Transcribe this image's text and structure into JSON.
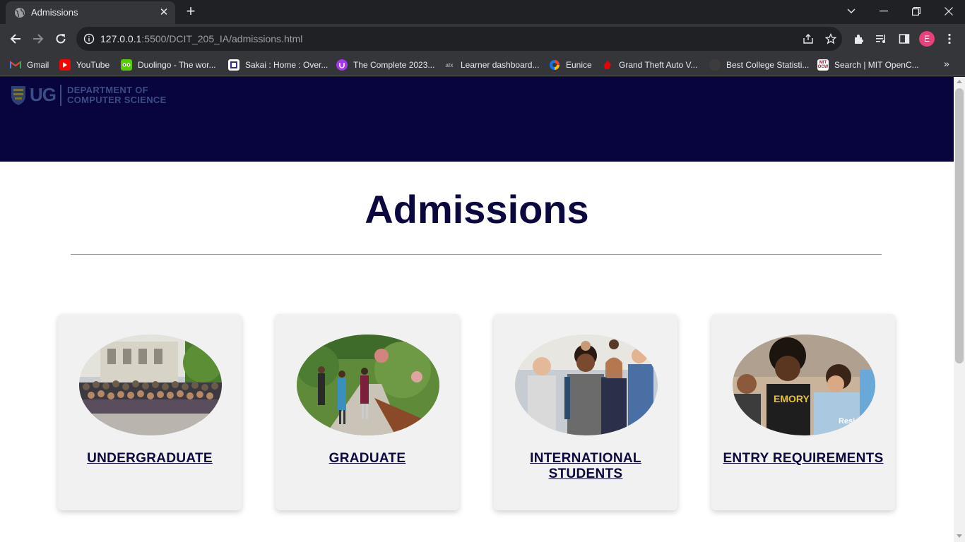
{
  "browser": {
    "tab_title": "Admissions",
    "url_host": "127.0.0.1",
    "url_rest": ":5500/DCIT_205_IA/admissions.html",
    "profile_initial": "E",
    "bookmarks": [
      {
        "label": "Gmail",
        "icon": "gmail-icon",
        "color": "#ea4335"
      },
      {
        "label": "YouTube",
        "icon": "youtube-icon",
        "color": "#ff0000"
      },
      {
        "label": "Duolingo - The wor...",
        "icon": "duolingo-icon",
        "color": "#58cc02"
      },
      {
        "label": "Sakai : Home : Over...",
        "icon": "sakai-icon",
        "color": "#ffffff"
      },
      {
        "label": "The Complete 2023...",
        "icon": "udemy-icon",
        "color": "#a435f0"
      },
      {
        "label": "Learner dashboard...",
        "icon": "alx-icon",
        "color": "#2b2b2b"
      },
      {
        "label": "Eunice",
        "icon": "eunice-icon",
        "color": "#1a73e8"
      },
      {
        "label": "Grand Theft Auto V...",
        "icon": "gta-icon",
        "color": "#e10600"
      },
      {
        "label": "Best College Statisti...",
        "icon": "stats-icon",
        "color": "#3c3c3c"
      },
      {
        "label": "Search | MIT OpenC...",
        "icon": "mit-ocw-icon",
        "color": "#a31f34"
      }
    ]
  },
  "site": {
    "logo_ug": "UG",
    "logo_dept_line1": "DEPARTMENT OF",
    "logo_dept_line2": "COMPUTER SCIENCE",
    "page_title": "Admissions"
  },
  "cards": [
    {
      "label": "UNDERGRADUATE",
      "photo": "undergraduate-photo"
    },
    {
      "label": "GRADUATE",
      "photo": "graduate-photo"
    },
    {
      "label": "INTERNATIONAL STUDENTS",
      "photo": "international-students-photo"
    },
    {
      "label": "ENTRY REQUIREMENTS",
      "photo": "entry-requirements-photo"
    }
  ],
  "colors": {
    "header_bg": "#08043d",
    "title_color": "#0b0840",
    "card_bg": "#f1f1f1"
  }
}
